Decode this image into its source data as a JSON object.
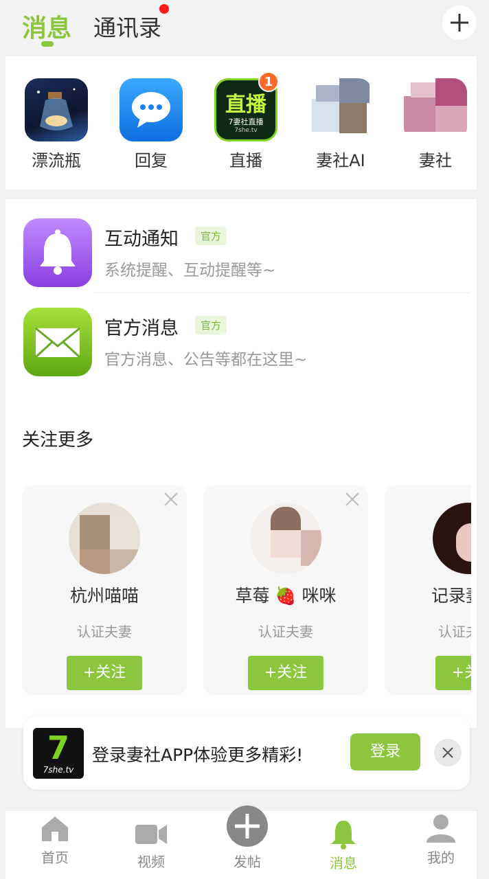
{
  "header": {
    "tab_messages": "消息",
    "tab_contacts": "通讯录",
    "plus_icon": "plus-icon"
  },
  "quick": [
    {
      "label": "漂流瓶",
      "icon": "bottle-icon"
    },
    {
      "label": "回复",
      "icon": "chat-bubble-icon"
    },
    {
      "label": "直播",
      "icon": "live-icon",
      "badge": "1"
    },
    {
      "label": "妻社AI",
      "icon": "ai-icon"
    },
    {
      "label": "妻社",
      "icon": "qishe-icon"
    }
  ],
  "live_icon_text": "直播",
  "live_icon_sub": "7妻社直播",
  "live_icon_url": "7she.tv",
  "notices": [
    {
      "title": "互动通知",
      "tag": "官方",
      "desc": "系统提醒、互动提醒等~",
      "icon": "bell-icon"
    },
    {
      "title": "官方消息",
      "tag": "官方",
      "desc": "官方消息、公告等都在这里~",
      "icon": "mail-icon"
    }
  ],
  "follow_more": "关注更多",
  "cards": [
    {
      "name": "杭州喵喵",
      "sub": "认证夫妻",
      "button": "+关注"
    },
    {
      "name": "草莓 🍓 咪咪",
      "sub": "认证夫妻",
      "button": "+关注"
    },
    {
      "name": "记录妻",
      "sub": "认证夫妻",
      "button": "+关注"
    }
  ],
  "login_banner": {
    "logo_text": "7she.tv",
    "text": "登录妻社APP体验更多精彩!",
    "button": "登录"
  },
  "nav": [
    {
      "label": "首页",
      "icon": "home-icon"
    },
    {
      "label": "视频",
      "icon": "video-icon"
    },
    {
      "label": "发帖",
      "icon": "post-plus-icon"
    },
    {
      "label": "消息",
      "icon": "bell-icon"
    },
    {
      "label": "我的",
      "icon": "profile-icon"
    }
  ],
  "colors": {
    "accent": "#8cc63f",
    "badge": "#ff6a2a",
    "red_dot": "#ff1a1a"
  }
}
